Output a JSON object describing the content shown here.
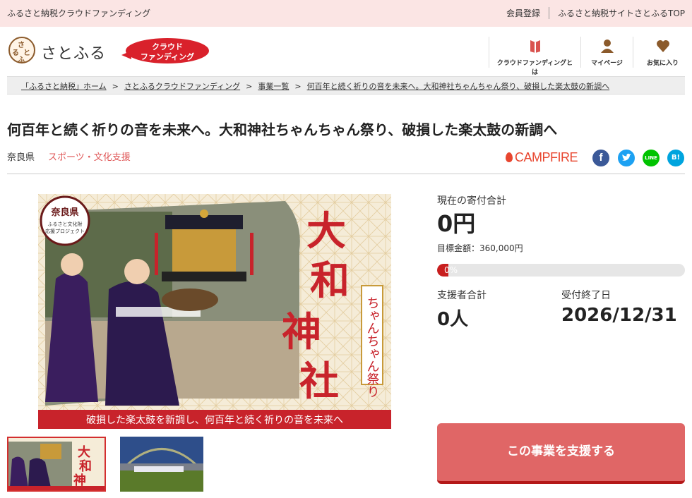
{
  "topbar": {
    "site_description": "ふるさと納税クラウドファンディング",
    "links": [
      "会員登録",
      "ふるさと納税サイトさとふるTOP"
    ]
  },
  "header": {
    "logo_text": "さとふる",
    "logo_mark_chars": [
      "さ",
      "と",
      "ふ",
      "る"
    ],
    "badge_line1": "クラウド",
    "badge_line2": "ファンディング",
    "nav": [
      {
        "label": "クラウドファンディングとは",
        "icon": "book-icon"
      },
      {
        "label": "マイページ",
        "icon": "person-icon"
      },
      {
        "label": "お気に入り",
        "icon": "heart-icon"
      }
    ]
  },
  "breadcrumb": {
    "items": [
      "「ふるさと納税」ホーム",
      "さとふるクラウドファンディング",
      "事業一覧",
      "何百年と続く祈りの音を未来へ。大和神社ちゃんちゃん祭り、破損した楽太鼓の新調へ"
    ],
    "separator": ">"
  },
  "project": {
    "title": "何百年と続く祈りの音を未来へ。大和神社ちゃんちゃん祭り、破損した楽太鼓の新調へ",
    "prefecture": "奈良県",
    "category": "スポーツ・文化支援",
    "partner": "CAMPFIRE",
    "share": {
      "facebook": "f",
      "hatena": "B!",
      "line": "LINE"
    }
  },
  "image": {
    "badge_pref": "奈良県",
    "badge_sub1": "ふるさと文化財",
    "badge_sub2": "応援プロジェクト",
    "big_chars": [
      "大",
      "和",
      "神",
      "社"
    ],
    "vertical_label": "ちゃんちゃん祭り",
    "banner": "破損した楽太鼓を新調し、何百年と続く祈りの音を未来へ"
  },
  "stats": {
    "total_label": "現在の寄付合計",
    "total_value": "0円",
    "goal_text": "目標金額：360,000円",
    "progress_percent": 0,
    "progress_text": "0%",
    "supporters_label": "支援者合計",
    "supporters_value": "0人",
    "deadline_label": "受付終了日",
    "deadline_value": "2026/12/31"
  },
  "cta": {
    "label": "この事業を支援する"
  },
  "colors": {
    "topbar_bg": "#fbe5e4",
    "accent_red": "#d9212b",
    "cta_bg": "#e06666",
    "category_text": "#e05a5a"
  }
}
